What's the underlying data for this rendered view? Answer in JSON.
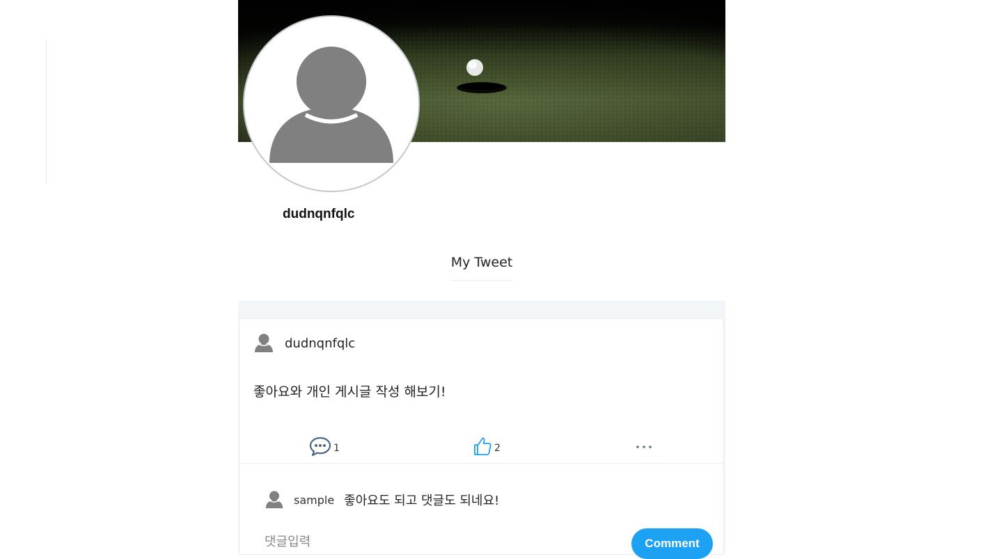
{
  "profile": {
    "username": "dudnqnfqlc"
  },
  "tabs": [
    {
      "label": "My Tweet"
    }
  ],
  "tweet": {
    "author": "dudnqnfqlc",
    "text": "좋아요와 개인 게시글 작성 해보기!",
    "comment_count": "1",
    "like_count": "2",
    "more_icon": "more-dots-icon"
  },
  "comments": [
    {
      "user": "sample",
      "text": "좋아요도 되고 댓글도 되네요!"
    }
  ],
  "comment_form": {
    "placeholder": "댓글입력",
    "button_label": "Comment"
  },
  "colors": {
    "accent": "#1da1f2",
    "avatar_gray": "#808080",
    "feed_bg": "#f3f6f9"
  }
}
